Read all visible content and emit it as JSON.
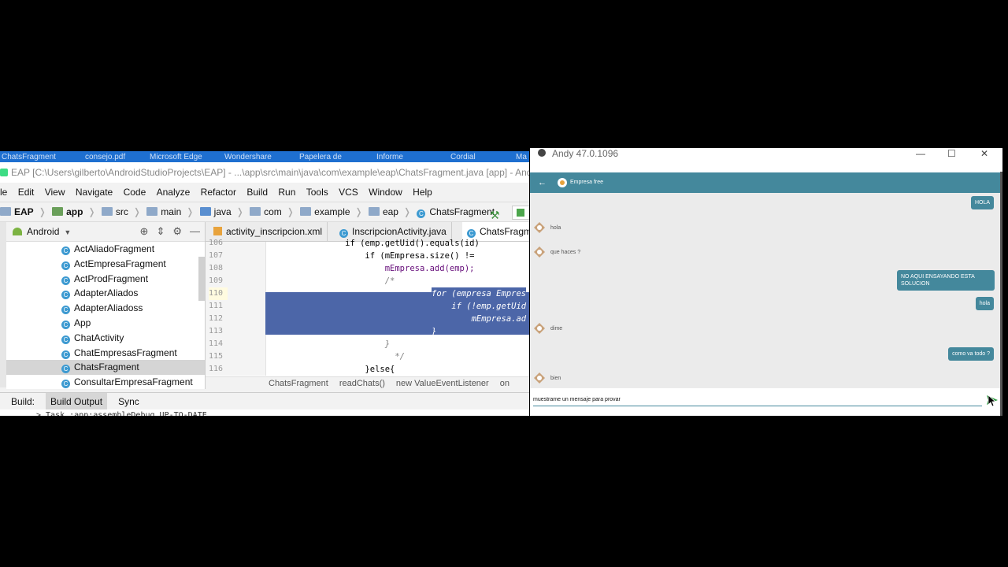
{
  "taskbar": {
    "items": [
      "ChatsFragment",
      "consejo.pdf",
      "Microsoft Edge",
      "Wondershare",
      "Papelera de",
      "Informe",
      "Cordial",
      "Ma"
    ]
  },
  "android_studio": {
    "title": "EAP [C:\\Users\\gilberto\\AndroidStudioProjects\\EAP] - ...\\app\\src\\main\\java\\com\\example\\eap\\ChatsFragment.java [app] - Android S",
    "menu": [
      "le",
      "Edit",
      "View",
      "Navigate",
      "Code",
      "Analyze",
      "Refactor",
      "Build",
      "Run",
      "Tools",
      "VCS",
      "Window",
      "Help"
    ],
    "breadcrumbs": [
      "EAP",
      "app",
      "src",
      "main",
      "java",
      "com",
      "example",
      "eap",
      "ChatsFragment"
    ],
    "project_view": "Android",
    "tree": [
      "ActAliadoFragment",
      "ActEmpresaFragment",
      "ActProdFragment",
      "AdapterAliados",
      "AdapterAliadoss",
      "App",
      "ChatActivity",
      "ChatEmpresasFragment",
      "ChatsFragment",
      "ConsultarEmpresaFragment"
    ],
    "selected_item": "ChatsFragment",
    "tabs": [
      "activity_inscripcion.xml",
      "InscripcionActivity.java",
      "ChatsFragme"
    ],
    "code_lines": [
      {
        "num": "106",
        "text": "                if (emp.getUid().equals(id)"
      },
      {
        "num": "107",
        "text": "                    if (mEmpresa.size() != "
      },
      {
        "num": "108",
        "text": "                        mEmpresa.add(emp);"
      },
      {
        "num": "109",
        "text": "                        /*"
      },
      {
        "num": "110",
        "text": "for (empresa Empres"
      },
      {
        "num": "111",
        "text": "    if (!emp.getUid"
      },
      {
        "num": "112",
        "text": "        mEmpresa.ad"
      },
      {
        "num": "113",
        "text": "}"
      },
      {
        "num": "114",
        "text": "                        }"
      },
      {
        "num": "115",
        "text": "                          */"
      },
      {
        "num": "116",
        "text": "                    }else{"
      }
    ],
    "editor_breadcrumb": [
      "ChatsFragment",
      "readChats()",
      "new ValueEventListener",
      "on"
    ],
    "build_tabs": [
      "Build:",
      "Build Output",
      "Sync"
    ],
    "build_log": "> Task :app:assembleDebug UP-TO-DATE"
  },
  "emulator": {
    "title": "Andy 47.0.1096",
    "app_title": "Empresa free",
    "messages": [
      {
        "side": "out",
        "text": "HOLA"
      },
      {
        "side": "in",
        "text": "hola"
      },
      {
        "side": "in",
        "text": "que haces ?"
      },
      {
        "side": "out",
        "text": "NO AQUI ENSAYANDO ESTA SOLUCION"
      },
      {
        "side": "out",
        "text": "hola"
      },
      {
        "side": "in",
        "text": "dime"
      },
      {
        "side": "out",
        "text": "como va todo ?"
      },
      {
        "side": "in",
        "text": "bien"
      }
    ],
    "input_value": "muestrame un mensaje para provar",
    "accent": "#44889c"
  }
}
